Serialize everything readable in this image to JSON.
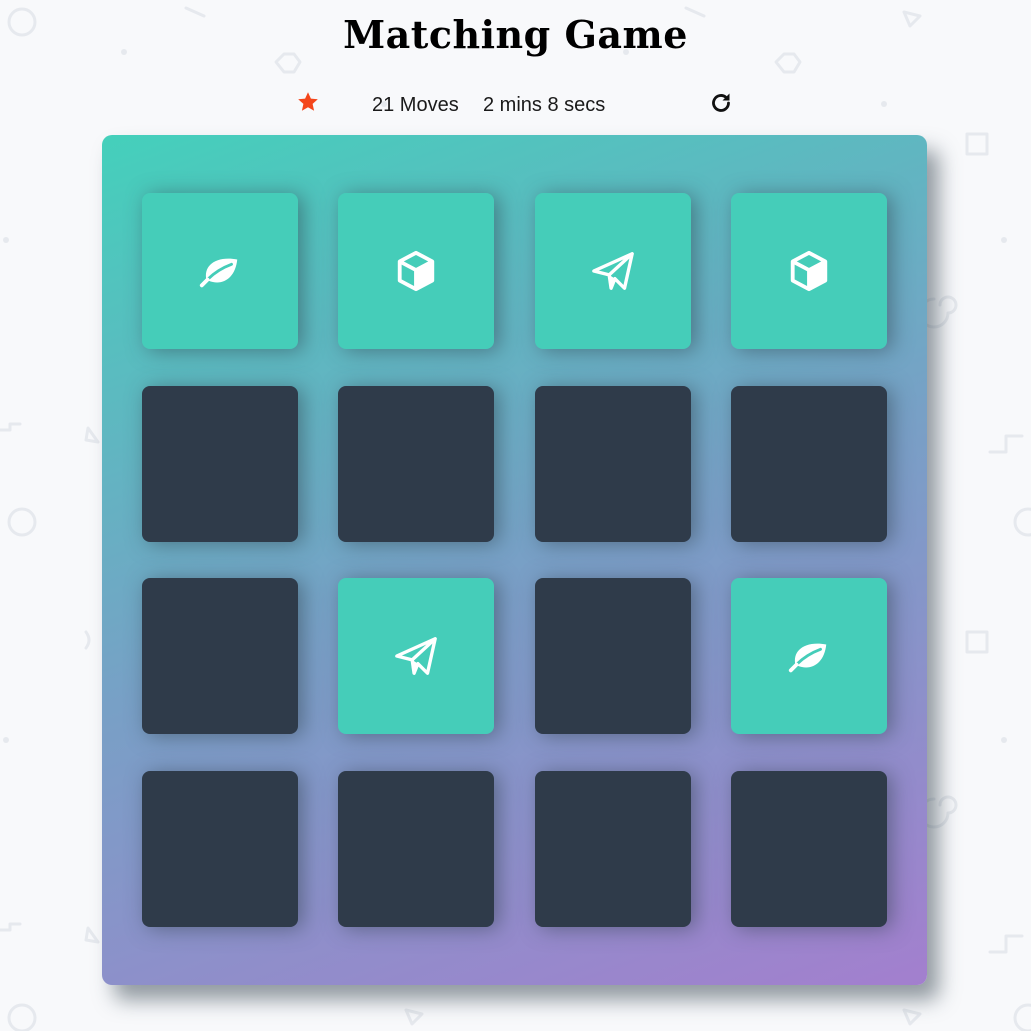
{
  "title": "Matching Game",
  "score_panel": {
    "stars": [
      {
        "icon": "star-icon",
        "color": "#f4461b"
      }
    ],
    "moves": "21 Moves",
    "timer": "2 mins 8 secs",
    "restart_icon": "repeat-icon"
  },
  "deck": {
    "gradient_colors": [
      "#44d0bb",
      "#78a0c6",
      "#a37fce"
    ],
    "card_back_color": "#2f3b4a",
    "card_match_color": "#45cdb9",
    "cards": [
      {
        "row": 1,
        "col": 1,
        "state": "match",
        "icon": "leaf-icon"
      },
      {
        "row": 1,
        "col": 2,
        "state": "match",
        "icon": "cube-icon"
      },
      {
        "row": 1,
        "col": 3,
        "state": "match",
        "icon": "paper-plane-icon"
      },
      {
        "row": 1,
        "col": 4,
        "state": "match",
        "icon": "cube-icon"
      },
      {
        "row": 2,
        "col": 1,
        "state": "hidden",
        "icon": null
      },
      {
        "row": 2,
        "col": 2,
        "state": "hidden",
        "icon": null
      },
      {
        "row": 2,
        "col": 3,
        "state": "hidden",
        "icon": null
      },
      {
        "row": 2,
        "col": 4,
        "state": "hidden",
        "icon": null
      },
      {
        "row": 3,
        "col": 1,
        "state": "hidden",
        "icon": null
      },
      {
        "row": 3,
        "col": 2,
        "state": "match",
        "icon": "paper-plane-icon"
      },
      {
        "row": 3,
        "col": 3,
        "state": "hidden",
        "icon": null
      },
      {
        "row": 3,
        "col": 4,
        "state": "match",
        "icon": "leaf-icon"
      },
      {
        "row": 4,
        "col": 1,
        "state": "hidden",
        "icon": null
      },
      {
        "row": 4,
        "col": 2,
        "state": "hidden",
        "icon": null
      },
      {
        "row": 4,
        "col": 3,
        "state": "hidden",
        "icon": null
      },
      {
        "row": 4,
        "col": 4,
        "state": "hidden",
        "icon": null
      }
    ]
  }
}
